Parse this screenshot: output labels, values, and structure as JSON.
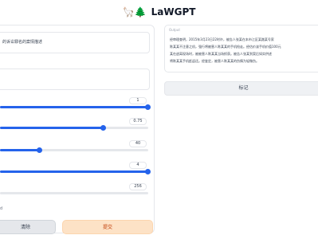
{
  "app": {
    "title": "LaWGPT",
    "title_icons": "🦙🌲"
  },
  "inputs": {
    "instruction_text": "的诉讼罪名的案情描述",
    "input_text": ""
  },
  "sliders": [
    {
      "value": "1",
      "fraction": 1.0
    },
    {
      "value": "0.75",
      "fraction": 0.7
    },
    {
      "value": "40",
      "fraction": 0.27
    },
    {
      "value": "4",
      "fraction": 1.0
    },
    {
      "value": "256",
      "fraction": 0.0
    }
  ],
  "stream_label": "d",
  "buttons": {
    "clear": "清除",
    "submit": "提交",
    "flag": "标记"
  },
  "output": {
    "label": "Output",
    "text": "经审理查明，2015年3月23日22时许，被告人张某在本市江区某路某号家\n陈某某不注意之机，强行将被害人陈某某的手机抢走。经估价该手机价值100元\n某在逃离现场时，被被害人陈某某当场抓获。被告人张某到案后如实供述\n将陈某某手机赶返还。经鉴定，被害人陈某某的伤情为轻微伤。"
  }
}
